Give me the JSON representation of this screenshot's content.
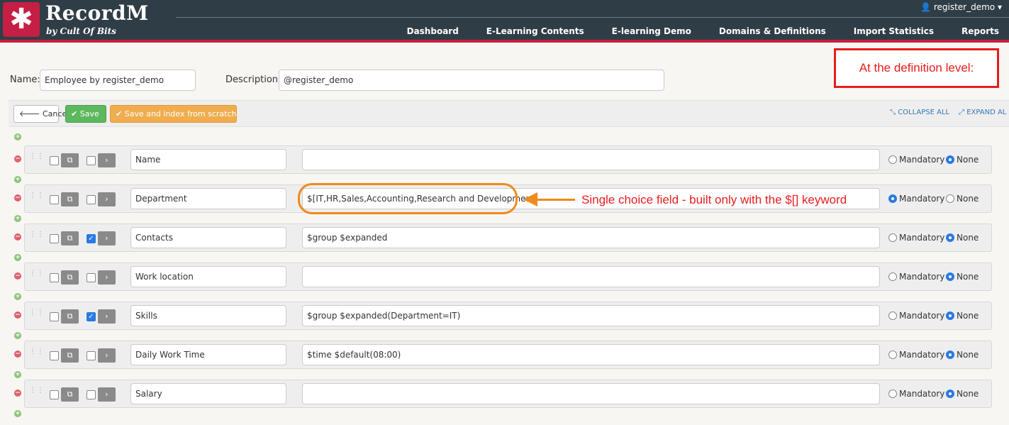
{
  "app": {
    "name": "RecordM",
    "tagline": "by Cult Of Bits",
    "logo_glyph": "✱"
  },
  "user": {
    "name": "register_demo"
  },
  "nav": [
    "Dashboard",
    "E-Learning Contents",
    "E-learning Demo",
    "Domains & Definitions",
    "Import Statistics",
    "Reports"
  ],
  "form": {
    "name_label": "Name:",
    "name_value": "Employee by register_demo",
    "description_label": "Description:",
    "description_value": "@register_demo"
  },
  "toolbar": {
    "cancel_label": "Cancel",
    "save_label": "Save",
    "save_index_label": "Save and index from scratch",
    "collapse_label": "COLLAPSE ALL",
    "expand_label": "EXPAND AL"
  },
  "radio_labels": {
    "mandatory": "Mandatory",
    "none": "None"
  },
  "fields": [
    {
      "name": "Name",
      "definition": "",
      "checked": false,
      "required": "None"
    },
    {
      "name": "Department",
      "definition": "$[IT,HR,Sales,Accounting,Research and Development]",
      "checked": false,
      "required": "Mandatory"
    },
    {
      "name": "Contacts",
      "definition": "$group $expanded",
      "checked": true,
      "required": "None"
    },
    {
      "name": "Work location",
      "definition": "",
      "checked": false,
      "required": "None"
    },
    {
      "name": "Skills",
      "definition": "$group $expanded(Department=IT)",
      "checked": true,
      "required": "None"
    },
    {
      "name": "Daily Work Time",
      "definition": "$time $default(08:00)",
      "checked": false,
      "required": "None"
    },
    {
      "name": "Salary",
      "definition": "",
      "checked": false,
      "required": "None"
    }
  ],
  "annotations": {
    "definition_level": "At the definition level:",
    "single_choice": "Single choice field - built only with the $[] keyword"
  },
  "colors": {
    "header": "#2f3e46",
    "brand_red": "#c51f45",
    "annotation_red": "#e81c1c",
    "annotation_orange": "#f08a1c",
    "save_green": "#5cb85c",
    "index_orange": "#f0ad4e"
  }
}
